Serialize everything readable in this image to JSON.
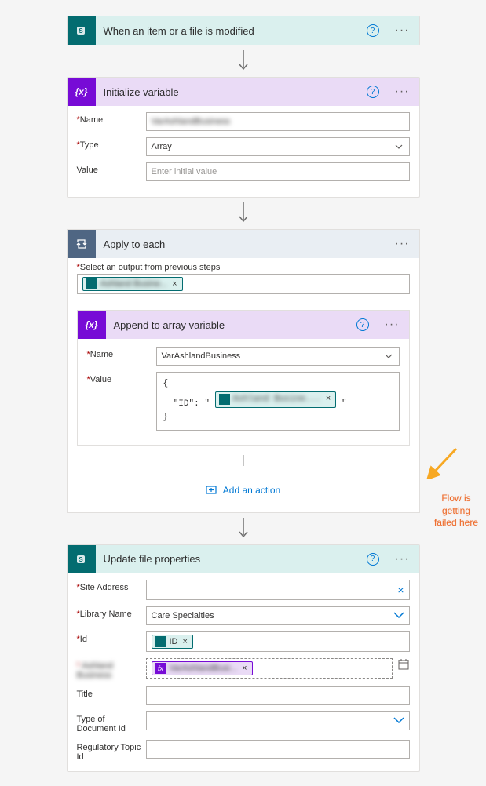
{
  "steps": {
    "trigger": {
      "title": "When an item or a file is modified"
    },
    "init_var": {
      "title": "Initialize variable",
      "name_label": "Name",
      "name_value": "VarAshlandBusiness",
      "type_label": "Type",
      "type_value": "Array",
      "value_label": "Value",
      "value_placeholder": "Enter initial value"
    },
    "apply_each": {
      "title": "Apply to each",
      "select_label": "Select an output from previous steps",
      "token_label": "Ashland Busine..."
    },
    "append_var": {
      "title": "Append to array variable",
      "name_label": "Name",
      "name_value": "VarAshlandBusiness",
      "value_label": "Value",
      "json_key": "\"ID\":",
      "token_label": "Ashland Busine..."
    },
    "add_action": "Add an action",
    "update_file": {
      "title": "Update file properties",
      "site_label": "Site Address",
      "lib_label": "Library Name",
      "lib_value": "Care Specialties",
      "id_label": "Id",
      "id_token": "ID",
      "ashland_label": "Ashland Business",
      "fx_token": "VarAshlandBusi...",
      "title_label": "Title",
      "type_doc_label": "Type of Document Id",
      "reg_label": "Regulatory Topic Id"
    }
  },
  "annotation": "Flow is getting failed here"
}
